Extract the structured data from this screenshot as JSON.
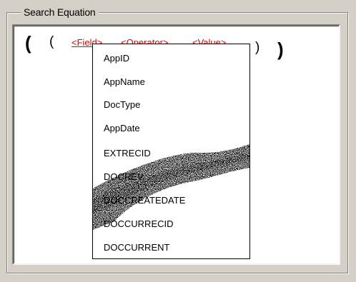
{
  "groupbox": {
    "title": "Search Equation"
  },
  "equation": {
    "open_outer": "(",
    "open_inner": "(",
    "close_inner": ")",
    "close_outer": ")",
    "field_token": "<Field>",
    "operator_token": "<Operator>",
    "value_token": "<Value>"
  },
  "dropdown": {
    "items": [
      "AppID",
      "AppName",
      "DocType",
      "AppDate",
      "EXTRECID",
      "DOCREV",
      "DOCCREATEDATE",
      "DOCCURRECID",
      "DOCCURRENT"
    ]
  },
  "colors": {
    "token_color": "#e00000",
    "window_bg": "#d4d0c8",
    "field_bg": "#ffffff"
  }
}
